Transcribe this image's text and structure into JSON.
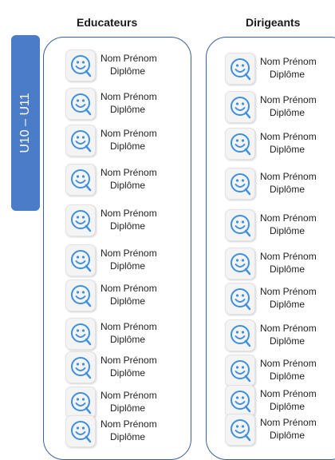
{
  "columns": {
    "educators_title": "Educateurs",
    "leaders_title": "Dirigeants"
  },
  "category_label": "U10 – U11",
  "icon": "smiley-logo-icon",
  "colors": {
    "tag": "#4a7cc7",
    "border": "#3a5f9a",
    "icon": "#3d8fe0"
  },
  "educators": [
    {
      "name": "Nom Prénom",
      "diploma": "Diplôme"
    },
    {
      "name": "Nom Prénom",
      "diploma": "Diplôme"
    },
    {
      "name": "Nom Prénom",
      "diploma": "Diplôme"
    },
    {
      "name": "Nom Prénom",
      "diploma": "Diplôme"
    },
    {
      "name": "Nom Prénom",
      "diploma": "Diplôme"
    },
    {
      "name": "Nom Prénom",
      "diploma": "Diplôme"
    },
    {
      "name": "Nom Prénom",
      "diploma": "Diplôme"
    },
    {
      "name": "Nom Prénom",
      "diploma": "Diplôme"
    },
    {
      "name": "Nom Prénom",
      "diploma": "Diplôme"
    },
    {
      "name": "Nom Prénom",
      "diploma": "Diplôme"
    },
    {
      "name": "Nom Prénom",
      "diploma": "Diplôme"
    }
  ],
  "leaders": [
    {
      "name": "Nom Prénom",
      "diploma": "Diplôme"
    },
    {
      "name": "Nom Prénom",
      "diploma": "Diplôme"
    },
    {
      "name": "Nom Prénom",
      "diploma": "Diplôme"
    },
    {
      "name": "Nom Prénom",
      "diploma": "Diplôme"
    },
    {
      "name": "Nom Prénom",
      "diploma": "Diplôme"
    },
    {
      "name": "Nom Prénom",
      "diploma": "Diplôme"
    },
    {
      "name": "Nom Prénom",
      "diploma": "Diplôme"
    },
    {
      "name": "Nom Prénom",
      "diploma": "Diplôme"
    },
    {
      "name": "Nom Prénom",
      "diploma": "Diplôme"
    },
    {
      "name": "Nom Prénom",
      "diploma": "Diplôme"
    },
    {
      "name": "Nom Prénom",
      "diploma": "Diplôme"
    }
  ]
}
